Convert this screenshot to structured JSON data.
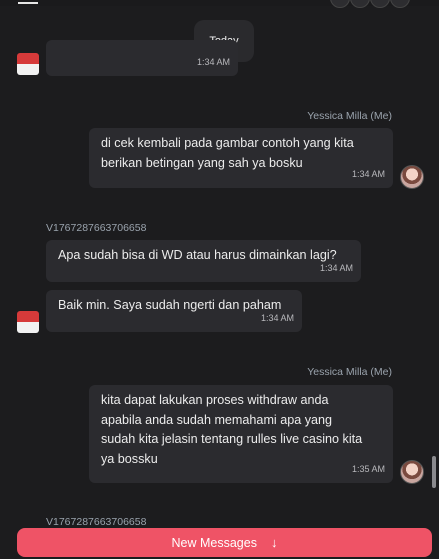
{
  "date_separator": "Today",
  "messages": [
    {
      "type": "incoming",
      "sender": "",
      "text": "",
      "time": "1:34 AM"
    },
    {
      "type": "outgoing",
      "sender": "Yessica Milla (Me)",
      "lines": [
        "di cek kembali pada gambar contoh yang kita",
        "berikan betingan yang sah ya bosku"
      ],
      "time": "1:34 AM"
    },
    {
      "type": "incoming",
      "sender": "V1767287663706658",
      "text": "Apa sudah bisa di WD atau harus dimainkan lagi?",
      "time": "1:34 AM"
    },
    {
      "type": "incoming",
      "sender": "",
      "text": "Baik min. Saya sudah ngerti dan paham",
      "time": "1:34 AM"
    },
    {
      "type": "outgoing",
      "sender": "Yessica Milla (Me)",
      "lines": [
        "kita dapat lakukan proses withdraw anda",
        "apabila anda sudah memahami apa yang",
        "sudah kita jelasin tentang rulles live casino kita",
        "ya bossku"
      ],
      "time": "1:35 AM"
    },
    {
      "type": "incoming",
      "sender": "V1767287663706658",
      "text": "",
      "time": ""
    }
  ],
  "new_messages_button": {
    "label": "New Messages",
    "icon": "arrow-down-icon"
  },
  "colors": {
    "background": "#1c1c1e",
    "bubble": "#2b2b2f",
    "accent": "#ef5366",
    "flag_red": "#d63a3a",
    "flag_white": "#f2f2f2"
  }
}
